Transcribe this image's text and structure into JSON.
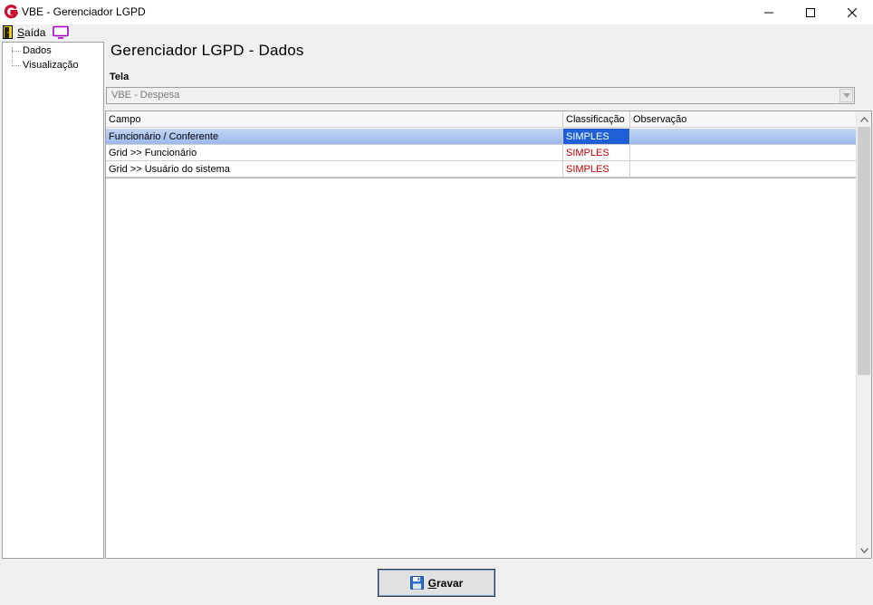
{
  "window": {
    "title": "VBE - Gerenciador LGPD"
  },
  "menu": {
    "exit_label_first": "S",
    "exit_label_rest": "aída"
  },
  "tree": {
    "items": [
      {
        "label": "Dados"
      },
      {
        "label": "Visualização"
      }
    ]
  },
  "main": {
    "title": "Gerenciador LGPD - Dados",
    "tela_label": "Tela",
    "tela_value": "VBE - Despesa"
  },
  "grid": {
    "columns": [
      "Campo",
      "Classificação",
      "Observação"
    ],
    "rows": [
      {
        "campo": "Funcionário / Conferente",
        "classificacao": "SIMPLES",
        "observacao": "",
        "selected": true
      },
      {
        "campo": "Grid >> Funcionário",
        "classificacao": "SIMPLES",
        "observacao": "",
        "selected": false
      },
      {
        "campo": "Grid >> Usuário do sistema",
        "classificacao": "SIMPLES",
        "observacao": "",
        "selected": false
      }
    ]
  },
  "footer": {
    "save_label_first": "G",
    "save_label_rest": "ravar"
  },
  "colors": {
    "classification_text": "#c00000",
    "selection_highlight": "#1e5fd6",
    "row_selection": "#9cb9ec",
    "logo_red": "#c8102e"
  },
  "icons": {
    "app": "vbe-logo-icon",
    "exit": "exit-door-icon",
    "screen": "monitor-icon",
    "save": "floppy-disk-icon"
  }
}
